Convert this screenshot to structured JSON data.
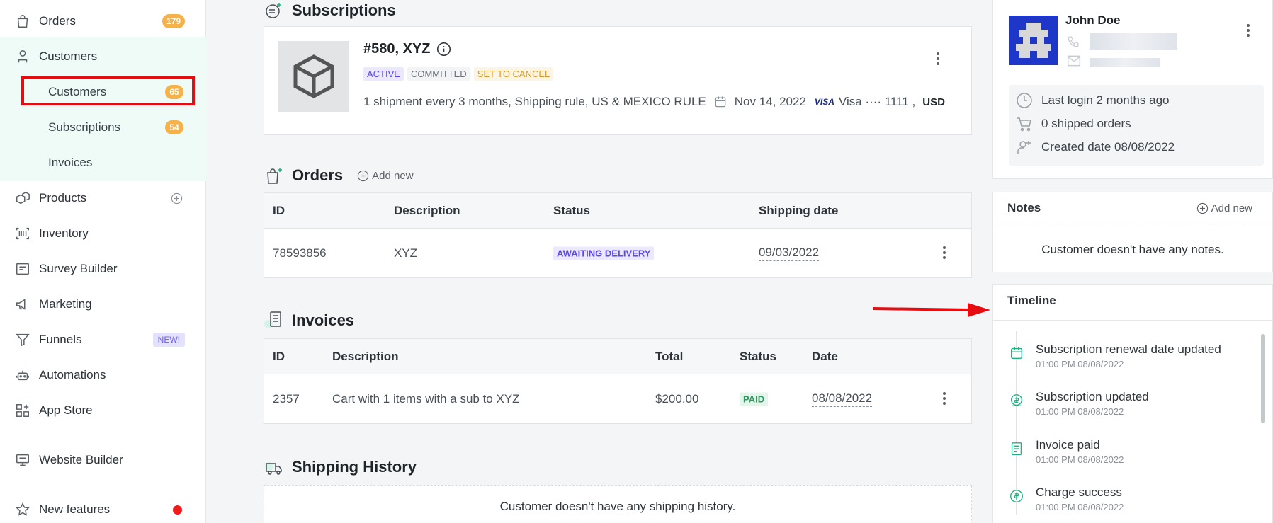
{
  "sidebar": {
    "items": [
      {
        "label": "Orders",
        "badge": "179"
      },
      {
        "label": "Customers"
      },
      {
        "label": "Products"
      },
      {
        "label": "Inventory"
      },
      {
        "label": "Survey Builder"
      },
      {
        "label": "Marketing"
      },
      {
        "label": "Funnels",
        "badge": "NEW!"
      },
      {
        "label": "Automations"
      },
      {
        "label": "App Store"
      },
      {
        "label": "Website Builder"
      },
      {
        "label": "New features"
      }
    ],
    "customer_sub": [
      {
        "label": "Customers",
        "badge": "65"
      },
      {
        "label": "Subscriptions",
        "badge": "54"
      },
      {
        "label": "Invoices"
      }
    ]
  },
  "subscriptions": {
    "title": "Subscriptions",
    "id": "#580, XYZ",
    "tags": [
      "ACTIVE",
      "COMMITTED",
      "SET TO CANCEL"
    ],
    "details": "1 shipment every 3 months, Shipping rule, US & MEXICO RULE",
    "date": "Nov 14, 2022",
    "visa_brand": "VISA",
    "card": "Visa ···· 1111 ,",
    "currency": "USD"
  },
  "orders": {
    "title": "Orders",
    "add_new": "Add new",
    "columns": [
      "ID",
      "Description",
      "Status",
      "Shipping date"
    ],
    "rows": [
      {
        "id": "78593856",
        "description": "XYZ",
        "status": "AWAITING DELIVERY",
        "date": "09/03/2022"
      }
    ]
  },
  "invoices": {
    "title": "Invoices",
    "columns": [
      "ID",
      "Description",
      "Total",
      "Status",
      "Date"
    ],
    "rows": [
      {
        "id": "2357",
        "description": "Cart with 1 items with a sub to XYZ",
        "total": "$200.00",
        "status": "PAID",
        "date": "08/08/2022"
      }
    ]
  },
  "shipping": {
    "title": "Shipping History",
    "empty": "Customer doesn't have any shipping history."
  },
  "customer": {
    "name": "John Doe",
    "last_login": "Last login 2 months ago",
    "shipped": "0 shipped orders",
    "created": "Created date 08/08/2022"
  },
  "notes": {
    "title": "Notes",
    "add_new": "Add new",
    "empty": "Customer doesn't have any notes."
  },
  "timeline": {
    "title": "Timeline",
    "items": [
      {
        "title": "Subscription renewal date updated",
        "time": "01:00 PM 08/08/2022"
      },
      {
        "title": "Subscription updated",
        "time": "01:00 PM 08/08/2022"
      },
      {
        "title": "Invoice paid",
        "time": "01:00 PM 08/08/2022"
      },
      {
        "title": "Charge success",
        "time": "01:00 PM 08/08/2022"
      }
    ]
  },
  "colors": {
    "accent_green": "#22b07d",
    "badge_orange": "#f5b14a",
    "highlight_red": "#e60d12",
    "purple": "#5a48e8"
  }
}
